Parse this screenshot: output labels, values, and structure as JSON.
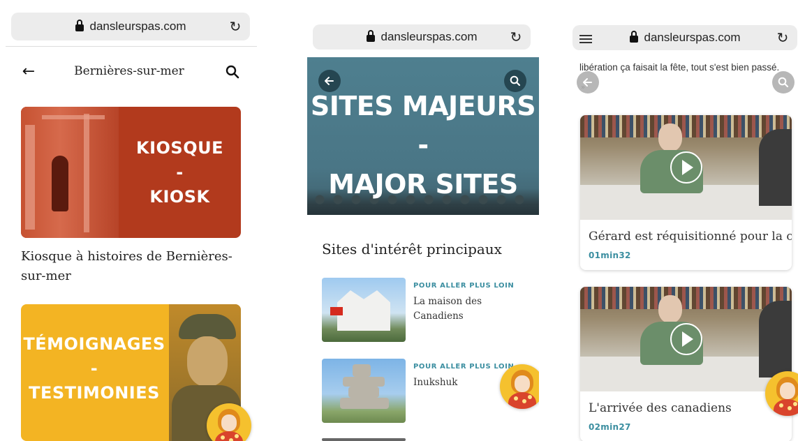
{
  "colors": {
    "kiosk_card": "#b23a1d",
    "testimony_card": "#f3b423",
    "hero_background": "#4e7f8f",
    "accent_teal": "#3b8ea0"
  },
  "screen1": {
    "url": "dansleurspas.com",
    "header_title": "Bernières-sur-mer",
    "kiosk_card": {
      "line1": "KIOSQUE",
      "dash": "-",
      "line2": "KIOSK"
    },
    "kiosk_caption": "Kiosque à histoires de Bernières-sur-mer",
    "testimony_card": {
      "line1": "TÉMOIGNAGES",
      "dash": "-",
      "line2": "TESTIMONIES"
    },
    "icons": {
      "back": "arrow-left-icon",
      "search": "search-icon",
      "lock": "lock-icon",
      "reload": "reload-icon"
    }
  },
  "screen2": {
    "url": "dansleurspas.com",
    "hero": {
      "line1": "SITES MAJEURS",
      "dash": "-",
      "line2": "MAJOR SITES"
    },
    "section_heading": "Sites d'intérêt principaux",
    "sites": [
      {
        "kicker": "POUR ALLER PLUS LOIN",
        "name": "La maison des Canadiens"
      },
      {
        "kicker": "POUR ALLER PLUS LOIN",
        "name": "Inukshuk"
      }
    ]
  },
  "screen3": {
    "url": "dansleurspas.com",
    "top_text": "libération ça faisait la fête, tout s'est bien passé.",
    "dots": "»",
    "videos": [
      {
        "title": "Gérard est réquisitionné pour la c",
        "duration": "01min32"
      },
      {
        "title": "L'arrivée des canadiens",
        "duration": "02min27"
      }
    ]
  }
}
